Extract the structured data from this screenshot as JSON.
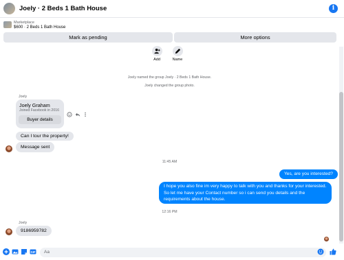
{
  "header": {
    "title": "Joely · 2 Beds 1 Bath House"
  },
  "marketplace": {
    "label": "Marketplace",
    "listing": "$600 · 2 Beds 1 Bath House"
  },
  "actions": {
    "pending": "Mark as pending",
    "more": "More options"
  },
  "group_actions": {
    "add": "Add",
    "name": "Name"
  },
  "system_messages": [
    "Joely named the group Joely · 2 Beds 1 Bath House.",
    "Joely changed the group photo."
  ],
  "thread": {
    "sender_1": "Joely",
    "card": {
      "name": "Joely Graham",
      "sub": "Joined Facebook in 2016",
      "button": "Buyer details"
    },
    "msg_1": "Can I tour the property!",
    "msg_2": "Message sent",
    "time_1": "11:45 AM",
    "out_1": "Yes, are you interested?",
    "out_2": "I hope you also fine im very happy to talk with you and thanks for your interested. So let me have your Contact number so i can send you details and the requirements about the house.",
    "time_2": "12:16 PM",
    "sender_2": "Joely",
    "msg_3": "9186959782"
  },
  "composer": {
    "placeholder": "Aa"
  },
  "colors": {
    "accent": "#1877f2",
    "outgoing": "#0084ff",
    "incoming": "#e4e6eb"
  }
}
